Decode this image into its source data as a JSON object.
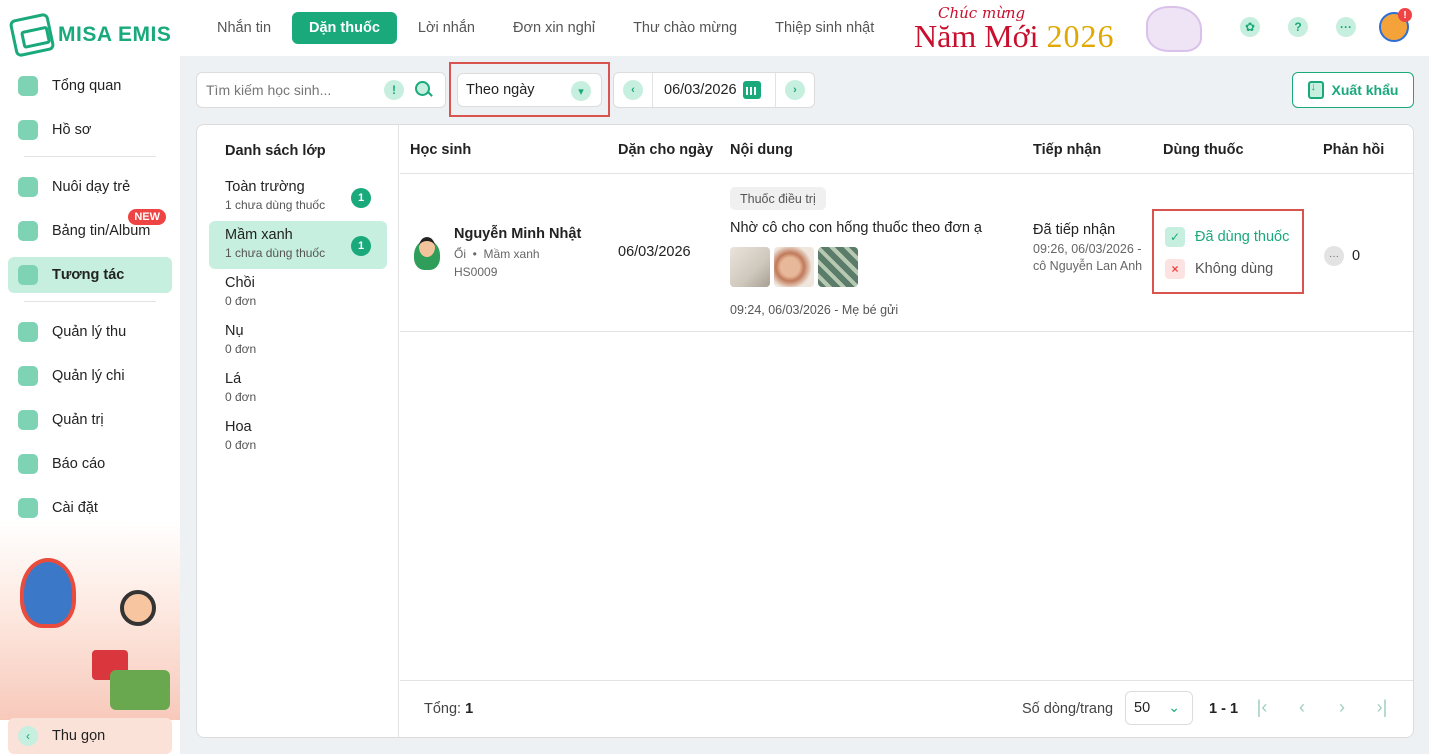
{
  "app": {
    "logo_text": "MISA EMIS"
  },
  "sidebar": {
    "items": [
      {
        "label": "Tổng quan",
        "icon": "pie-chart-icon"
      },
      {
        "label": "Hồ sơ",
        "icon": "folder-icon"
      },
      {
        "label": "Nuôi dạy trẻ",
        "icon": "heart-icon"
      },
      {
        "label": "Bảng tin/Album",
        "icon": "image-icon",
        "badge": "NEW"
      },
      {
        "label": "Tương tác",
        "icon": "send-icon",
        "active": true
      },
      {
        "label": "Quản lý thu",
        "icon": "trend-icon"
      },
      {
        "label": "Quản lý chi",
        "icon": "wallet-icon"
      },
      {
        "label": "Quản trị",
        "icon": "admin-icon"
      },
      {
        "label": "Báo cáo",
        "icon": "bar-chart-icon"
      },
      {
        "label": "Cài đặt",
        "icon": "gear-icon"
      }
    ],
    "collapse_label": "Thu gọn"
  },
  "topbar": {
    "tabs": [
      "Nhắn tin",
      "Dặn thuốc",
      "Lời nhắn",
      "Đơn xin nghỉ",
      "Thư chào mừng",
      "Thiệp sinh nhật"
    ],
    "active_tab": "Dặn thuốc",
    "banner_small": "Chúc mừng",
    "banner_big": "Năm Mới",
    "banner_year": "2026"
  },
  "filters": {
    "search_placeholder": "Tìm kiếm học sinh...",
    "mode": "Theo ngày",
    "date": "06/03/2026",
    "export_label": "Xuất khẩu"
  },
  "classes": {
    "title": "Danh sách lớp",
    "items": [
      {
        "name": "Toàn trường",
        "sub": "1 chưa dùng thuốc",
        "badge": "1"
      },
      {
        "name": "Mầm xanh",
        "sub": "1 chưa dùng thuốc",
        "badge": "1",
        "active": true
      },
      {
        "name": "Chồi",
        "sub": "0 đơn"
      },
      {
        "name": "Nụ",
        "sub": "0 đơn"
      },
      {
        "name": "Lá",
        "sub": "0 đơn"
      },
      {
        "name": "Hoa",
        "sub": "0 đơn"
      }
    ]
  },
  "table": {
    "headers": {
      "student": "Học sinh",
      "for_date": "Dặn cho ngày",
      "content": "Nội dung",
      "received": "Tiếp nhận",
      "usage": "Dùng thuốc",
      "reply": "Phản hồi"
    },
    "rows": [
      {
        "name": "Nguyễn Minh Nhật",
        "nickname": "Ổi",
        "class": "Mầm xanh",
        "id": "HS0009",
        "for_date": "06/03/2026",
        "tag": "Thuốc điều trị",
        "text": "Nhờ cô cho con hống thuốc theo đơn ạ",
        "sent": "09:24, 06/03/2026 - Mẹ bé gửi",
        "received_status": "Đã tiếp nhận",
        "received_detail": "09:26, 06/03/2026 - cô Nguyễn Lan Anh",
        "usage_yes": "Đã dùng thuốc",
        "usage_no": "Không dùng",
        "reply_count": "0"
      }
    ]
  },
  "footer": {
    "total_label": "Tổng:",
    "total_value": "1",
    "rows_per_page_label": "Số dòng/trang",
    "rows_per_page": "50",
    "range": "1 - 1"
  },
  "colors": {
    "accent": "#19a97b",
    "accent_light": "#c6efdf",
    "highlight_border": "#d9534f",
    "badge_red": "#ef4444"
  }
}
